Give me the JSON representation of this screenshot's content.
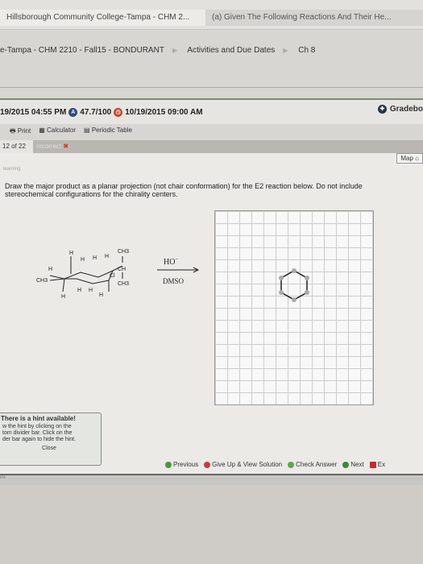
{
  "tabs": [
    {
      "label": "Hillsborough Community College-Tampa - CHM 2..."
    },
    {
      "label": "(a) Given The Following Reactions And Their He..."
    }
  ],
  "breadcrumb": [
    "e-Tampa - CHM 2210 - Fall15 - BONDURANT",
    "Activities and Due Dates",
    "Ch 8"
  ],
  "status": {
    "start": "19/2015 04:55 PM",
    "score": "47.7/100",
    "due": "10/19/2015 09:00 AM",
    "gradebook": "Gradebo"
  },
  "tools": {
    "print": "Print",
    "calculator": "Calculator",
    "periodic": "Periodic Table"
  },
  "question": {
    "number": "12 of 22",
    "status": "Incorrect",
    "map": "Map",
    "brand": "learning",
    "text": "Draw the major product as a planar projection (not chair conformation) for the E2 reaction below. Do not include stereochemical configurations for the chirality centers."
  },
  "reaction": {
    "reagent": "HO",
    "charge": "−",
    "solvent": "DMSO",
    "labels": {
      "h": "H",
      "ch3": "CH3",
      "ch": "CH",
      "cl": "Cl"
    }
  },
  "hint": {
    "title": "There is a hint available!",
    "body1": "w the hint by clicking on the",
    "body2": "tom divider bar. Click on the",
    "body3": "der bar again to hide the hint.",
    "close": "Close"
  },
  "nav": {
    "previous": "Previous",
    "giveup": "Give Up & View Solution",
    "check": "Check Answer",
    "next": "Next",
    "exit": "Ex"
  },
  "bottom": {
    "label": "int"
  },
  "colors": {
    "accent": "#7b8f6a",
    "score_badge": "#2a4a8a",
    "due_badge": "#c8452a",
    "incorrect": "#e0403a"
  }
}
